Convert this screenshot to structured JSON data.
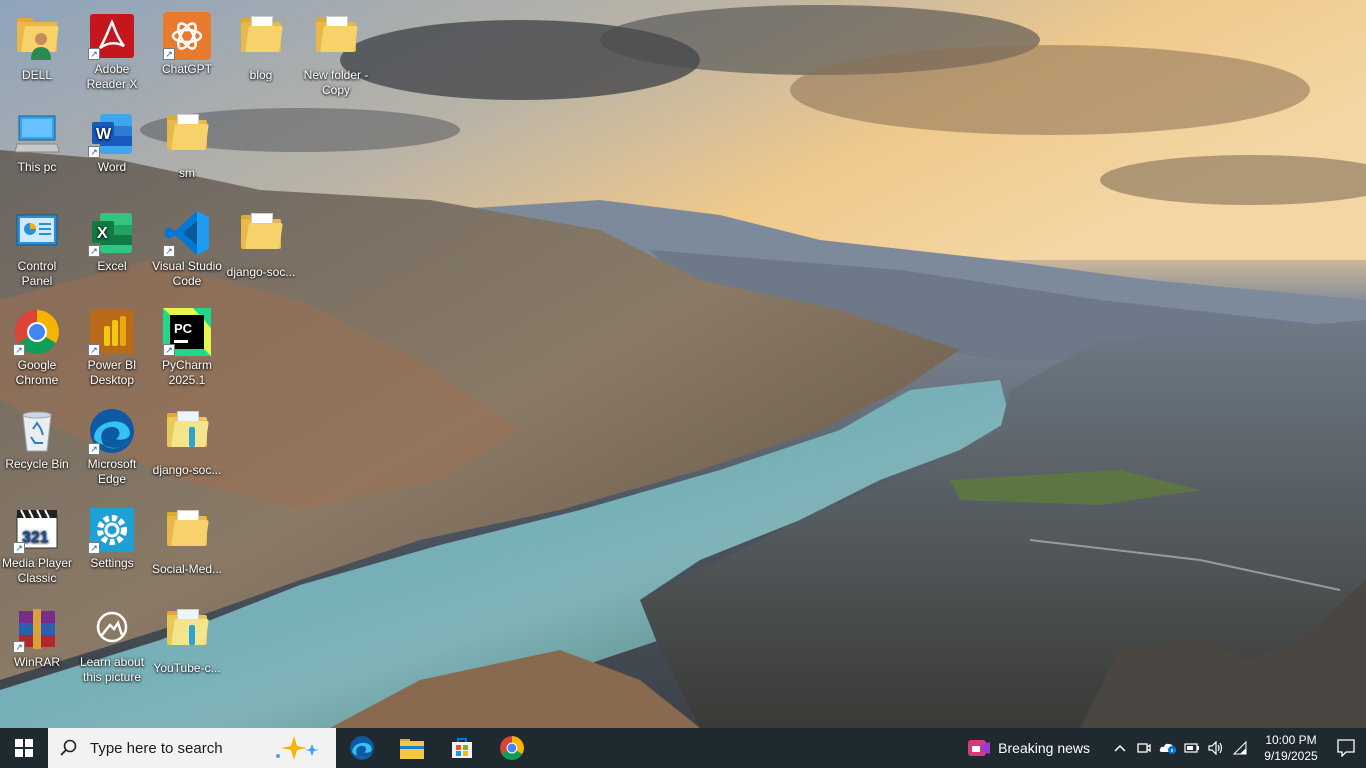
{
  "desktop": {
    "icons": [
      {
        "label": "DELL",
        "icon": "user-folder-icon"
      },
      {
        "label": "Adobe Reader X",
        "icon": "adobe-reader-icon"
      },
      {
        "label": "ChatGPT",
        "icon": "chatgpt-icon"
      },
      {
        "label": "blog",
        "icon": "folder-icon"
      },
      {
        "label": "New folder - Copy",
        "icon": "folder-icon"
      },
      {
        "label": "This pc",
        "icon": "computer-icon"
      },
      {
        "label": "Word",
        "icon": "word-icon"
      },
      {
        "label": "sm",
        "icon": "folder-icon"
      },
      {
        "label": "Control Panel",
        "icon": "control-panel-icon"
      },
      {
        "label": "Excel",
        "icon": "excel-icon"
      },
      {
        "label": "Visual Studio Code",
        "icon": "vscode-icon"
      },
      {
        "label": "django-soc...",
        "icon": "folder-icon"
      },
      {
        "label": "Google Chrome",
        "icon": "chrome-icon"
      },
      {
        "label": "Power BI Desktop",
        "icon": "power-bi-icon"
      },
      {
        "label": "PyCharm 2025.1",
        "icon": "pycharm-icon"
      },
      {
        "label": "Recycle Bin",
        "icon": "recycle-bin-icon"
      },
      {
        "label": "Microsoft Edge",
        "icon": "edge-icon"
      },
      {
        "label": "django-soc...",
        "icon": "folder-icon"
      },
      {
        "label": "Media Player Classic",
        "icon": "media-player-icon"
      },
      {
        "label": "Settings",
        "icon": "settings-icon"
      },
      {
        "label": "Social-Med...",
        "icon": "folder-icon"
      },
      {
        "label": "WinRAR",
        "icon": "winrar-icon"
      },
      {
        "label": "Learn about this picture",
        "icon": "learn-picture-icon"
      },
      {
        "label": "YouTube-c...",
        "icon": "folder-icon"
      }
    ]
  },
  "taskbar": {
    "search_placeholder": "Type here to search",
    "pinned": [
      {
        "name": "Microsoft Edge",
        "icon": "edge-icon"
      },
      {
        "name": "File Explorer",
        "icon": "file-explorer-icon"
      },
      {
        "name": "Microsoft Store",
        "icon": "store-icon"
      },
      {
        "name": "Google Chrome",
        "icon": "chrome-icon"
      }
    ],
    "news_label": "Breaking news",
    "time": "10:00 PM",
    "date": "9/19/2025"
  },
  "colors": {
    "taskbar_bg": "#1e2a30",
    "search_bg": "#f2f2f2",
    "accent": "#0078d4"
  }
}
